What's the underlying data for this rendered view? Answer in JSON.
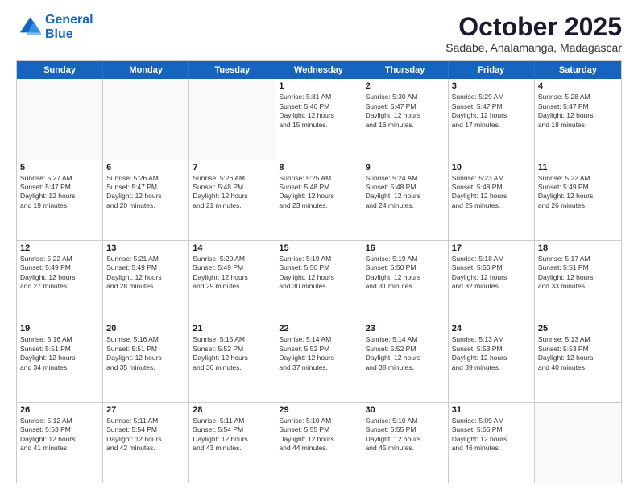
{
  "logo": {
    "line1": "General",
    "line2": "Blue"
  },
  "title": "October 2025",
  "location": "Sadabe, Analamanga, Madagascar",
  "days_header": [
    "Sunday",
    "Monday",
    "Tuesday",
    "Wednesday",
    "Thursday",
    "Friday",
    "Saturday"
  ],
  "rows": [
    [
      {
        "num": "",
        "text": ""
      },
      {
        "num": "",
        "text": ""
      },
      {
        "num": "",
        "text": ""
      },
      {
        "num": "1",
        "text": "Sunrise: 5:31 AM\nSunset: 5:46 PM\nDaylight: 12 hours\nand 15 minutes."
      },
      {
        "num": "2",
        "text": "Sunrise: 5:30 AM\nSunset: 5:47 PM\nDaylight: 12 hours\nand 16 minutes."
      },
      {
        "num": "3",
        "text": "Sunrise: 5:29 AM\nSunset: 5:47 PM\nDaylight: 12 hours\nand 17 minutes."
      },
      {
        "num": "4",
        "text": "Sunrise: 5:28 AM\nSunset: 5:47 PM\nDaylight: 12 hours\nand 18 minutes."
      }
    ],
    [
      {
        "num": "5",
        "text": "Sunrise: 5:27 AM\nSunset: 5:47 PM\nDaylight: 12 hours\nand 19 minutes."
      },
      {
        "num": "6",
        "text": "Sunrise: 5:26 AM\nSunset: 5:47 PM\nDaylight: 12 hours\nand 20 minutes."
      },
      {
        "num": "7",
        "text": "Sunrise: 5:26 AM\nSunset: 5:48 PM\nDaylight: 12 hours\nand 21 minutes."
      },
      {
        "num": "8",
        "text": "Sunrise: 5:25 AM\nSunset: 5:48 PM\nDaylight: 12 hours\nand 23 minutes."
      },
      {
        "num": "9",
        "text": "Sunrise: 5:24 AM\nSunset: 5:48 PM\nDaylight: 12 hours\nand 24 minutes."
      },
      {
        "num": "10",
        "text": "Sunrise: 5:23 AM\nSunset: 5:48 PM\nDaylight: 12 hours\nand 25 minutes."
      },
      {
        "num": "11",
        "text": "Sunrise: 5:22 AM\nSunset: 5:49 PM\nDaylight: 12 hours\nand 26 minutes."
      }
    ],
    [
      {
        "num": "12",
        "text": "Sunrise: 5:22 AM\nSunset: 5:49 PM\nDaylight: 12 hours\nand 27 minutes."
      },
      {
        "num": "13",
        "text": "Sunrise: 5:21 AM\nSunset: 5:49 PM\nDaylight: 12 hours\nand 28 minutes."
      },
      {
        "num": "14",
        "text": "Sunrise: 5:20 AM\nSunset: 5:49 PM\nDaylight: 12 hours\nand 29 minutes."
      },
      {
        "num": "15",
        "text": "Sunrise: 5:19 AM\nSunset: 5:50 PM\nDaylight: 12 hours\nand 30 minutes."
      },
      {
        "num": "16",
        "text": "Sunrise: 5:19 AM\nSunset: 5:50 PM\nDaylight: 12 hours\nand 31 minutes."
      },
      {
        "num": "17",
        "text": "Sunrise: 5:18 AM\nSunset: 5:50 PM\nDaylight: 12 hours\nand 32 minutes."
      },
      {
        "num": "18",
        "text": "Sunrise: 5:17 AM\nSunset: 5:51 PM\nDaylight: 12 hours\nand 33 minutes."
      }
    ],
    [
      {
        "num": "19",
        "text": "Sunrise: 5:16 AM\nSunset: 5:51 PM\nDaylight: 12 hours\nand 34 minutes."
      },
      {
        "num": "20",
        "text": "Sunrise: 5:16 AM\nSunset: 5:51 PM\nDaylight: 12 hours\nand 35 minutes."
      },
      {
        "num": "21",
        "text": "Sunrise: 5:15 AM\nSunset: 5:52 PM\nDaylight: 12 hours\nand 36 minutes."
      },
      {
        "num": "22",
        "text": "Sunrise: 5:14 AM\nSunset: 5:52 PM\nDaylight: 12 hours\nand 37 minutes."
      },
      {
        "num": "23",
        "text": "Sunrise: 5:14 AM\nSunset: 5:52 PM\nDaylight: 12 hours\nand 38 minutes."
      },
      {
        "num": "24",
        "text": "Sunrise: 5:13 AM\nSunset: 5:53 PM\nDaylight: 12 hours\nand 39 minutes."
      },
      {
        "num": "25",
        "text": "Sunrise: 5:13 AM\nSunset: 5:53 PM\nDaylight: 12 hours\nand 40 minutes."
      }
    ],
    [
      {
        "num": "26",
        "text": "Sunrise: 5:12 AM\nSunset: 5:53 PM\nDaylight: 12 hours\nand 41 minutes."
      },
      {
        "num": "27",
        "text": "Sunrise: 5:11 AM\nSunset: 5:54 PM\nDaylight: 12 hours\nand 42 minutes."
      },
      {
        "num": "28",
        "text": "Sunrise: 5:11 AM\nSunset: 5:54 PM\nDaylight: 12 hours\nand 43 minutes."
      },
      {
        "num": "29",
        "text": "Sunrise: 5:10 AM\nSunset: 5:55 PM\nDaylight: 12 hours\nand 44 minutes."
      },
      {
        "num": "30",
        "text": "Sunrise: 5:10 AM\nSunset: 5:55 PM\nDaylight: 12 hours\nand 45 minutes."
      },
      {
        "num": "31",
        "text": "Sunrise: 5:09 AM\nSunset: 5:55 PM\nDaylight: 12 hours\nand 46 minutes."
      },
      {
        "num": "",
        "text": ""
      }
    ]
  ]
}
